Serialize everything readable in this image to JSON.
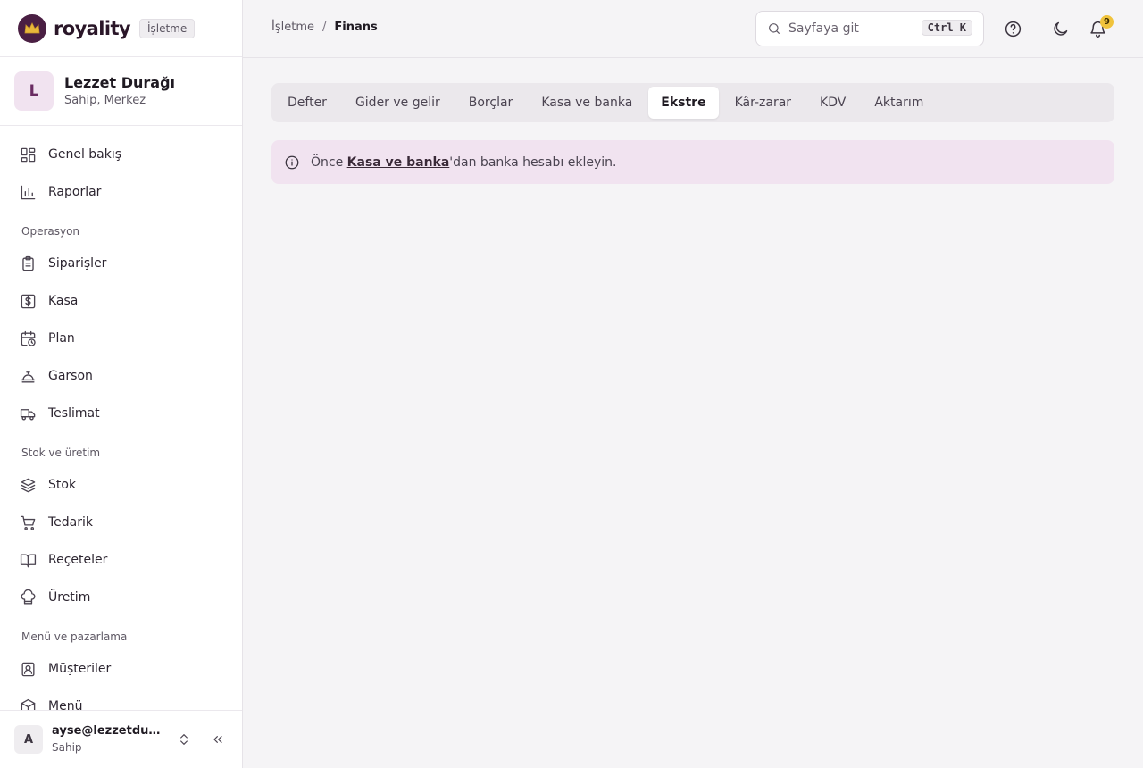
{
  "brand": {
    "name": "royality",
    "badge": "İşletme"
  },
  "org": {
    "initial": "L",
    "name": "Lezzet Durağı",
    "role": "Sahip, Merkez"
  },
  "nav": {
    "top": [
      {
        "label": "Genel bakış",
        "icon": "dashboard-icon"
      },
      {
        "label": "Raporlar",
        "icon": "bar-chart-icon"
      }
    ],
    "sections": [
      {
        "title": "Operasyon",
        "items": [
          {
            "label": "Siparişler",
            "icon": "clipboard-icon"
          },
          {
            "label": "Kasa",
            "icon": "dollar-icon"
          },
          {
            "label": "Plan",
            "icon": "calendar-clock-icon"
          },
          {
            "label": "Garson",
            "icon": "cloche-icon"
          },
          {
            "label": "Teslimat",
            "icon": "truck-icon"
          }
        ]
      },
      {
        "title": "Stok ve üretim",
        "items": [
          {
            "label": "Stok",
            "icon": "stack-icon"
          },
          {
            "label": "Tedarik",
            "icon": "cart-icon"
          },
          {
            "label": "Reçeteler",
            "icon": "book-icon"
          },
          {
            "label": "Üretim",
            "icon": "chef-hat-icon"
          }
        ]
      },
      {
        "title": "Menü ve pazarlama",
        "items": [
          {
            "label": "Müşteriler",
            "icon": "contact-icon"
          },
          {
            "label": "Menü",
            "icon": "package-icon"
          }
        ]
      }
    ]
  },
  "user": {
    "initial": "A",
    "email": "ayse@lezzetdurağı.com",
    "role": "Sahip"
  },
  "header": {
    "breadcrumb": {
      "parent": "İşletme",
      "separator": "/",
      "current": "Finans"
    },
    "search_placeholder": "Sayfaya git",
    "shortcut": "Ctrl K",
    "notification_count": "9"
  },
  "tabs": [
    {
      "label": "Defter",
      "active": false
    },
    {
      "label": "Gider ve gelir",
      "active": false
    },
    {
      "label": "Borçlar",
      "active": false
    },
    {
      "label": "Kasa ve banka",
      "active": false
    },
    {
      "label": "Ekstre",
      "active": true
    },
    {
      "label": "Kâr-zarar",
      "active": false
    },
    {
      "label": "KDV",
      "active": false
    },
    {
      "label": "Aktarım",
      "active": false
    }
  ],
  "alert": {
    "prefix": "Önce ",
    "link": "Kasa ve banka",
    "suffix": "'dan banka hesabı ekleyin."
  },
  "colors": {
    "brand": "#4a1f43",
    "accent_bg": "#f1e3f0",
    "badge": "#f0c33c"
  }
}
